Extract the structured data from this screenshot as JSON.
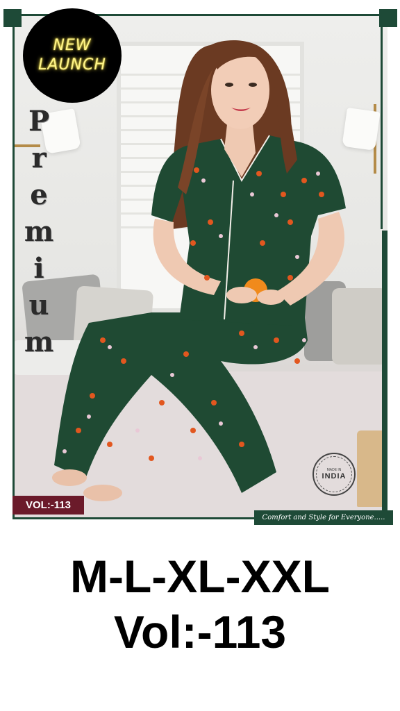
{
  "badge": {
    "line1": "NEW",
    "line2": "LAUNCH"
  },
  "premium_letters": [
    "P",
    "r",
    "e",
    "m",
    "i",
    "u",
    "m"
  ],
  "vol_badge": "VOL:-113",
  "stamp": {
    "center": "INDIA",
    "ring": "MADE IN"
  },
  "tagline": "Comfort and Style for Everyone.....",
  "sizes": "M-L-XL-XXL",
  "volume": "Vol:-113",
  "colors": {
    "frame": "#1e4a37",
    "vol_badge": "#6b1a2a",
    "pajama": "#1f4a33",
    "glow": "#fff58a"
  }
}
